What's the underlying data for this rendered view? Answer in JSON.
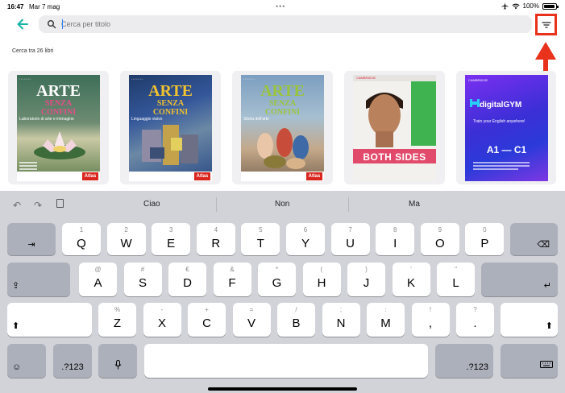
{
  "status": {
    "time": "16:47",
    "date": "Mar 7 mag",
    "battery": "100%"
  },
  "search": {
    "placeholder": "Cerca per titolo",
    "value": ""
  },
  "count_label": "Cerca tra 26 libri",
  "books": [
    {
      "title": "ARTE",
      "line2": "SENZA",
      "line3": "CONFINI",
      "tag": "Laboratorio di arte e immagine",
      "publisher": "Atlas"
    },
    {
      "title": "ARTE",
      "line2": "SENZA",
      "line3": "CONFINI",
      "tag": "Linguaggio visivo",
      "publisher": "Atlas"
    },
    {
      "title": "ARTE",
      "line2": "SENZA",
      "line3": "CONFINI",
      "tag": "Storia dell'arte",
      "publisher": "Atlas"
    },
    {
      "title": "BOTH SIDES",
      "publisher": "CAMBRIDGE"
    },
    {
      "title": "digitalGYM",
      "brand": "CAMBRIDGE",
      "tagline": "Train your English anywhere!",
      "level": "A1 — C1"
    }
  ],
  "keyboard": {
    "suggestions": [
      "Ciao",
      "Non",
      "Ma"
    ],
    "row1": [
      {
        "hint": "1",
        "label": "Q"
      },
      {
        "hint": "2",
        "label": "W"
      },
      {
        "hint": "3",
        "label": "E"
      },
      {
        "hint": "4",
        "label": "R"
      },
      {
        "hint": "5",
        "label": "T"
      },
      {
        "hint": "6",
        "label": "Y"
      },
      {
        "hint": "7",
        "label": "U"
      },
      {
        "hint": "8",
        "label": "I"
      },
      {
        "hint": "9",
        "label": "O"
      },
      {
        "hint": "0",
        "label": "P"
      }
    ],
    "row2": [
      {
        "hint": "@",
        "label": "A"
      },
      {
        "hint": "#",
        "label": "S"
      },
      {
        "hint": "€",
        "label": "D"
      },
      {
        "hint": "&",
        "label": "F"
      },
      {
        "hint": "*",
        "label": "G"
      },
      {
        "hint": "(",
        "label": "H"
      },
      {
        "hint": ")",
        "label": "J"
      },
      {
        "hint": "'",
        "label": "K"
      },
      {
        "hint": "\"",
        "label": "L"
      }
    ],
    "row3": [
      {
        "hint": "%",
        "label": "Z"
      },
      {
        "hint": "-",
        "label": "X"
      },
      {
        "hint": "+",
        "label": "C"
      },
      {
        "hint": "=",
        "label": "V"
      },
      {
        "hint": "/",
        "label": "B"
      },
      {
        "hint": ";",
        "label": "N"
      },
      {
        "hint": ":",
        "label": "M"
      },
      {
        "hint": "!",
        "label": ","
      },
      {
        "hint": "?",
        "label": "."
      }
    ],
    "numbers_label": ".?123"
  },
  "colors": {
    "accent": "#1ab4a8",
    "highlight": "#e8321c"
  },
  "icons": {
    "back": "arrow-left-icon",
    "search": "search-icon",
    "filter": "filter-icon"
  }
}
